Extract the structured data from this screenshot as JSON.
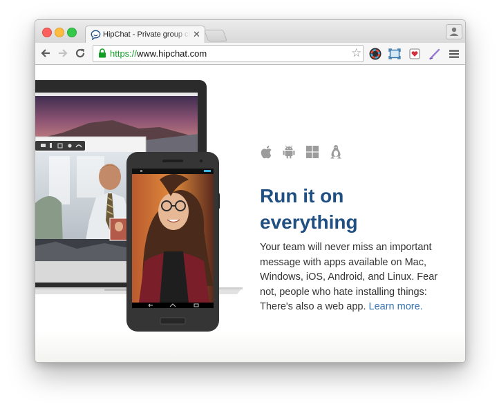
{
  "browser": {
    "tab": {
      "title": "HipChat - Private group chat"
    },
    "address_bar": {
      "scheme": "https://",
      "host": "www.hipchat.com"
    },
    "icons": {
      "back": "back-arrow-icon",
      "forward": "forward-arrow-icon",
      "reload": "reload-icon",
      "lock": "lock-icon",
      "bookmark": "star-icon",
      "menu": "hamburger-menu-icon"
    }
  },
  "page": {
    "heading": "Run it on everything",
    "body": "Your team will never miss an important message with apps available on Mac, Windows, iOS, Android, and Linux. Fear not, people who hate installing things: There's also a web app. ",
    "learn_more": "Learn more.",
    "platforms": [
      "apple-icon",
      "android-icon",
      "windows-icon",
      "linux-icon"
    ],
    "colors": {
      "heading": "#205081",
      "link": "#3572b0",
      "https": "#139e27"
    }
  }
}
